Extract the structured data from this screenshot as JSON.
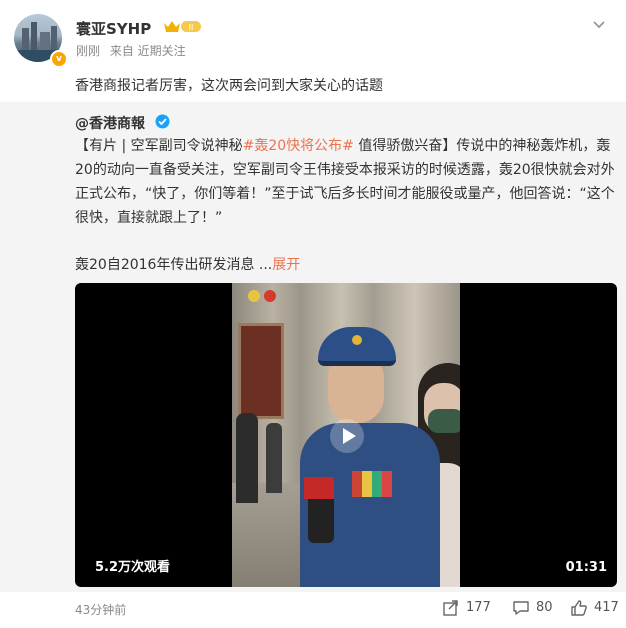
{
  "post": {
    "author": {
      "name": "寰亚SYHP",
      "level": "II"
    },
    "meta": {
      "time": "刚刚",
      "source": "来自 近期关注"
    },
    "text": "香港商报记者厉害，这次两会问到大家关心的话题"
  },
  "repost": {
    "author": "@香港商報",
    "body": {
      "prefix": "【有片 | 空军副司令说神秘",
      "hashtag": "#轰20快将公布#",
      "rest": " 值得骄傲兴奋】传说中的神秘轰炸机，轰20的动向一直备受关注，空军副司令王伟接受本报采访的时候透露，轰20很快就会对外正式公布，“快了，你们等着！”至于试飞后多长时间才能服役或量产，他回答说：“这个很快，直接就跟上了！”"
    },
    "summary": "轰20自2016年传出研发消息",
    "ellipsis": "...",
    "expand_label": "展开",
    "video": {
      "views": "5.2万次观看",
      "duration": "01:31"
    }
  },
  "footer": {
    "timestamp": "43分钟前",
    "shares": "177",
    "comments": "80",
    "likes": "417"
  },
  "colors": {
    "accent": "#eb7350",
    "verified_blue": "#1da1f2",
    "gold": "#f7a700"
  },
  "icons": [
    "chevron-down-icon",
    "verified-icon",
    "play-icon",
    "share-icon",
    "comment-icon",
    "like-icon"
  ]
}
